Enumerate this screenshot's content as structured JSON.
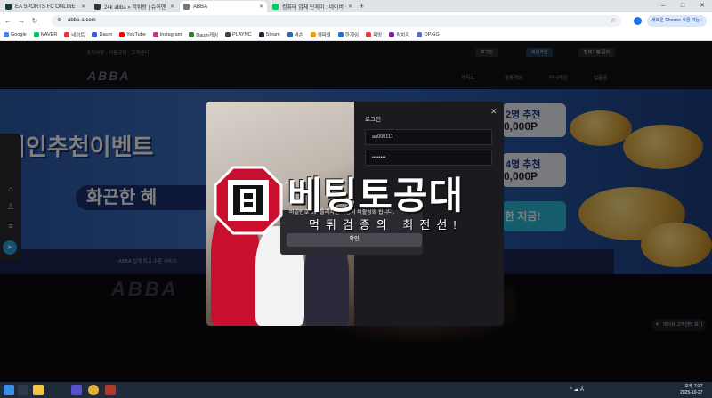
{
  "browser": {
    "tabs": [
      {
        "title": "EA SPORTS FC ONLINE",
        "color": "#1c3b2a",
        "active": false
      },
      {
        "title": "24k abba » 먹튀랑 | 슈어맨",
        "color": "#222222",
        "active": false
      },
      {
        "title": "ABBA",
        "color": "#555555",
        "active": true
      },
      {
        "title": "컴퓨터 업체 단체미 : 네이버 검",
        "color": "#03c75a",
        "active": false
      }
    ],
    "new_tab": "+",
    "window_controls": [
      "–",
      "□",
      "✕"
    ],
    "url": "abba-a.com",
    "chrome_button": "새로운 Chrome 사용 가능 :",
    "bookmarks": [
      {
        "label": "Google",
        "color": "#4285f4"
      },
      {
        "label": "NAVER",
        "color": "#03c75a"
      },
      {
        "label": "네이트",
        "color": "#e53935"
      },
      {
        "label": "Daum",
        "color": "#3b5bdb"
      },
      {
        "label": "YouTube",
        "color": "#ff0000"
      },
      {
        "label": "Instagram",
        "color": "#c13584"
      },
      {
        "label": "Daum게임",
        "color": "#2e7d32"
      },
      {
        "label": "PLAYNC",
        "color": "#444444"
      },
      {
        "label": "Steam",
        "color": "#1b2838"
      },
      {
        "label": "넥슨",
        "color": "#2b6cb0"
      },
      {
        "label": "엠파블",
        "color": "#f59f00"
      },
      {
        "label": "한게임",
        "color": "#1976d2"
      },
      {
        "label": "피망",
        "color": "#e53935"
      },
      {
        "label": "락차지",
        "color": "#7b1fa2"
      },
      {
        "label": "OP.GG",
        "color": "#5c6bc0"
      }
    ]
  },
  "site": {
    "top_links": "공지사항 · 이용규정 · 고객센터",
    "login_btn": "로그인",
    "join_btn": "회원가입",
    "support_btn": "텔레그램 문의",
    "logo": "ABBA",
    "menu": [
      "카지노",
      "슬롯게임",
      "미니게임",
      "입출금"
    ],
    "hero_headline": "지인추천이벤트",
    "hero_sub": "화끈한 혜",
    "hero_footer": "- ABBA 업계 최고 수준 서비스 -",
    "promo_cards": [
      {
        "line1": "2명 추천",
        "line2": "0,000P"
      },
      {
        "line1": "4명 추천",
        "line2": "0,000P"
      }
    ],
    "promo_button": "한 지금!",
    "lower_logo": "ABBA",
    "chat_widget": "라이브 고객센터 보기"
  },
  "modal": {
    "title": "로그인",
    "username_value": "aa000111",
    "password_value": "••••••••",
    "close": "✕",
    "warning": "비밀번호 5회 틀리시면 계정이 비활성화 됩니다.",
    "confirm_label": "확인"
  },
  "watermark": {
    "title": "베팅토공대",
    "subtitle": "먹튀검증의 최전선!",
    "emblem_color": "#c8102e"
  },
  "taskbar": {
    "tray": "^ ☁ A",
    "time": "오후 7:37",
    "date": "2025-10-27"
  }
}
